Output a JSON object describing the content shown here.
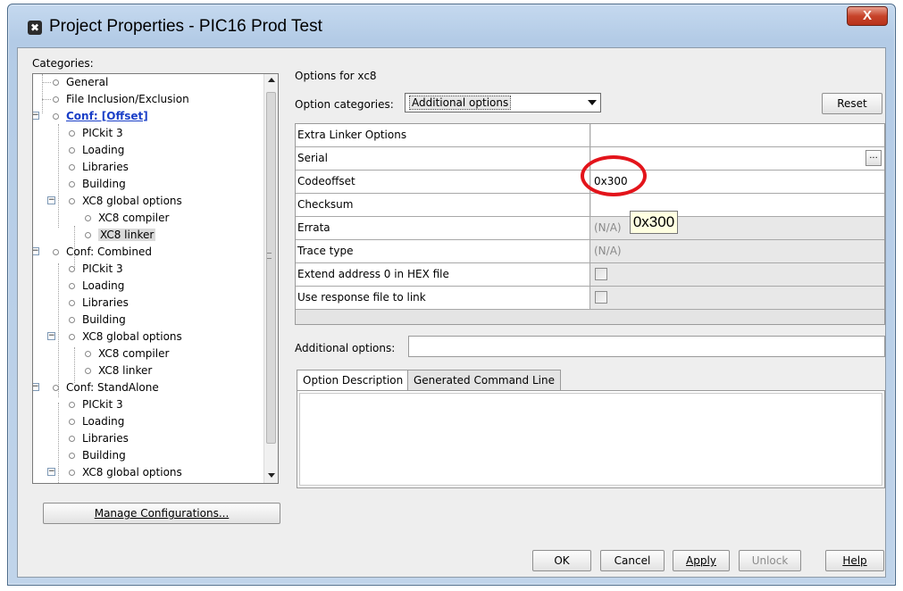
{
  "window": {
    "title": "Project Properties - PIC16 Prod Test",
    "close_glyph": "X"
  },
  "categories": {
    "label": "Categories:",
    "items": [
      {
        "label": "General"
      },
      {
        "label": "File Inclusion/Exclusion"
      },
      {
        "label": "Conf: [Offset]"
      },
      {
        "label": "PICkit 3"
      },
      {
        "label": "Loading"
      },
      {
        "label": "Libraries"
      },
      {
        "label": "Building"
      },
      {
        "label": "XC8 global options"
      },
      {
        "label": "XC8 compiler"
      },
      {
        "label": "XC8 linker"
      },
      {
        "label": "Conf: Combined"
      },
      {
        "label": "PICkit 3"
      },
      {
        "label": "Loading"
      },
      {
        "label": "Libraries"
      },
      {
        "label": "Building"
      },
      {
        "label": "XC8 global options"
      },
      {
        "label": "XC8 compiler"
      },
      {
        "label": "XC8 linker"
      },
      {
        "label": "Conf: StandAlone"
      },
      {
        "label": "PICkit 3"
      },
      {
        "label": "Loading"
      },
      {
        "label": "Libraries"
      },
      {
        "label": "Building"
      },
      {
        "label": "XC8 global options"
      }
    ],
    "manage_button": "Manage Configurations..."
  },
  "options": {
    "header": "Options for xc8",
    "category_label": "Option categories:",
    "category_value": "Additional options",
    "reset_button": "Reset",
    "properties": [
      {
        "name": "Extra Linker Options",
        "value": ""
      },
      {
        "name": "Serial",
        "value": ""
      },
      {
        "name": "Codeoffset",
        "value": "0x300"
      },
      {
        "name": "Checksum",
        "value": ""
      },
      {
        "name": "Errata",
        "value": "(N/A)"
      },
      {
        "name": "Trace type",
        "value": "(N/A)"
      },
      {
        "name": "Extend address 0 in HEX file",
        "value": ""
      },
      {
        "name": "Use response file to link",
        "value": ""
      }
    ],
    "tooltip": "0x300",
    "additional_label": "Additional options:",
    "additional_value": "",
    "tabs": [
      "Option Description",
      "Generated Command Line"
    ]
  },
  "buttons": {
    "ok": "OK",
    "cancel": "Cancel",
    "apply": "Apply",
    "unlock": "Unlock",
    "help": "Help"
  },
  "colors": {
    "link": "#1a3fc7",
    "highlight_circle": "#e3141b",
    "tooltip_bg": "#ffffe1"
  }
}
